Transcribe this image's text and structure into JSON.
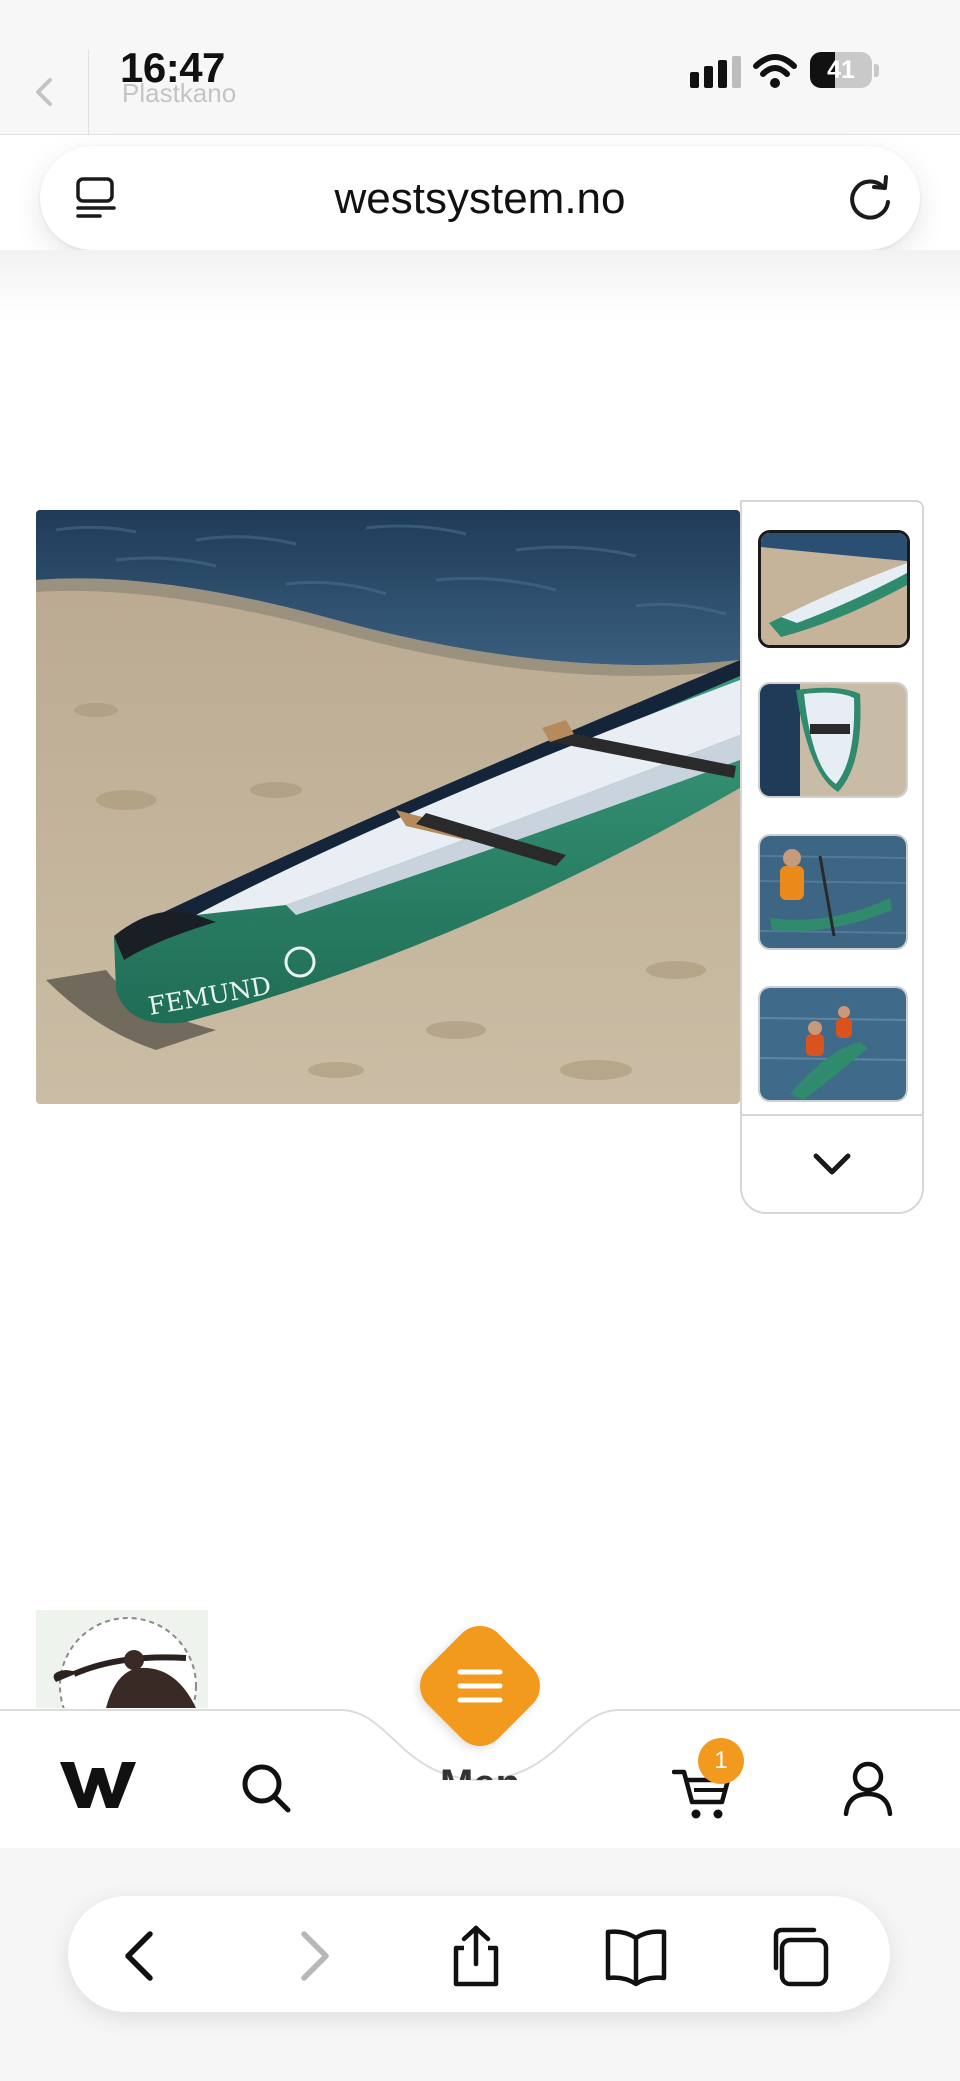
{
  "status_bar": {
    "time": "16:47",
    "battery_level": "41",
    "battery_fraction": 0.41
  },
  "top_bar": {
    "page_title": "Plastkano"
  },
  "address_bar": {
    "url": "westsystem.no"
  },
  "product": {
    "hull_text": "FEMUND",
    "thumbnails": [
      {
        "name": "canoe-on-beach",
        "active": true
      },
      {
        "name": "canoe-top-view",
        "active": false
      },
      {
        "name": "paddler-solo",
        "active": false
      },
      {
        "name": "paddlers-tandem",
        "active": false
      }
    ]
  },
  "bottom_nav": {
    "cart_count": "1",
    "hidden_label": "Meny",
    "accent_color": "#f29a1e"
  },
  "colors": {
    "hull_green": "#2f8a6e",
    "sand": "#c5b49a",
    "water": "#2b4f72"
  }
}
